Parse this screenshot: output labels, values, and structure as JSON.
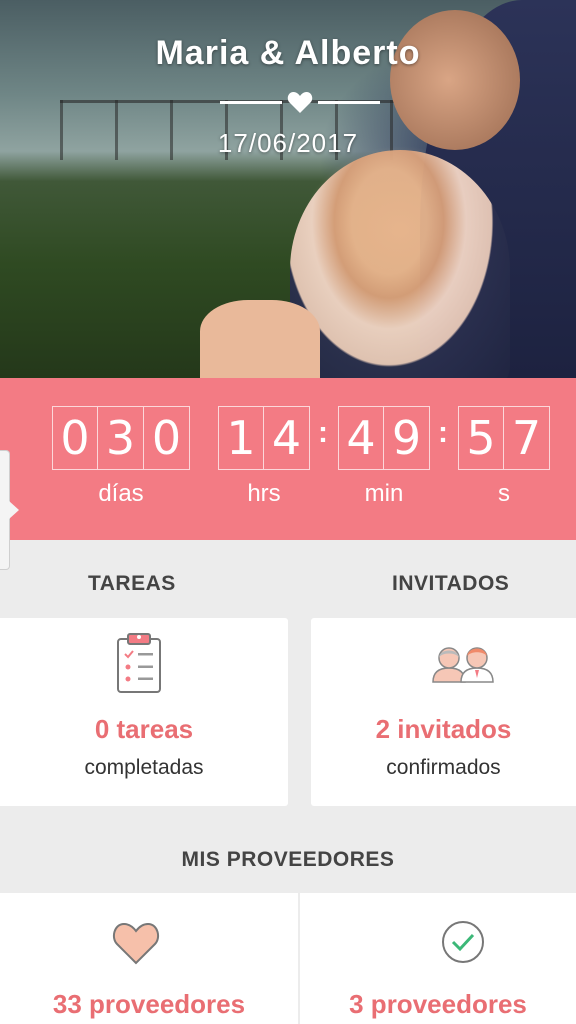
{
  "hero": {
    "couple_names": "Maria & Alberto",
    "wedding_date": "17/06/2017",
    "heart_icon": "heart-icon"
  },
  "countdown": {
    "days": [
      "0",
      "3",
      "0"
    ],
    "hours": [
      "1",
      "4"
    ],
    "minutes": [
      "4",
      "9"
    ],
    "seconds": [
      "5",
      "7"
    ],
    "separator": ":",
    "labels": {
      "days": "días",
      "hours": "hrs",
      "minutes": "min",
      "seconds": "s"
    },
    "background_color": "#f37b84"
  },
  "tareas": {
    "title": "TAREAS",
    "count_label": "0 tareas",
    "status_label": "completadas",
    "icon": "clipboard-icon"
  },
  "invitados": {
    "title": "INVITADOS",
    "count_label": "2 invitados",
    "status_label": "confirmados",
    "icon": "guests-icon"
  },
  "proveedores": {
    "title": "MIS PROVEEDORES",
    "favorites_label": "33 proveedores",
    "favorites_icon": "heart-outline-icon",
    "hired_label": "3 proveedores",
    "hired_icon": "check-circle-icon"
  },
  "accent_color": "#e96e73"
}
